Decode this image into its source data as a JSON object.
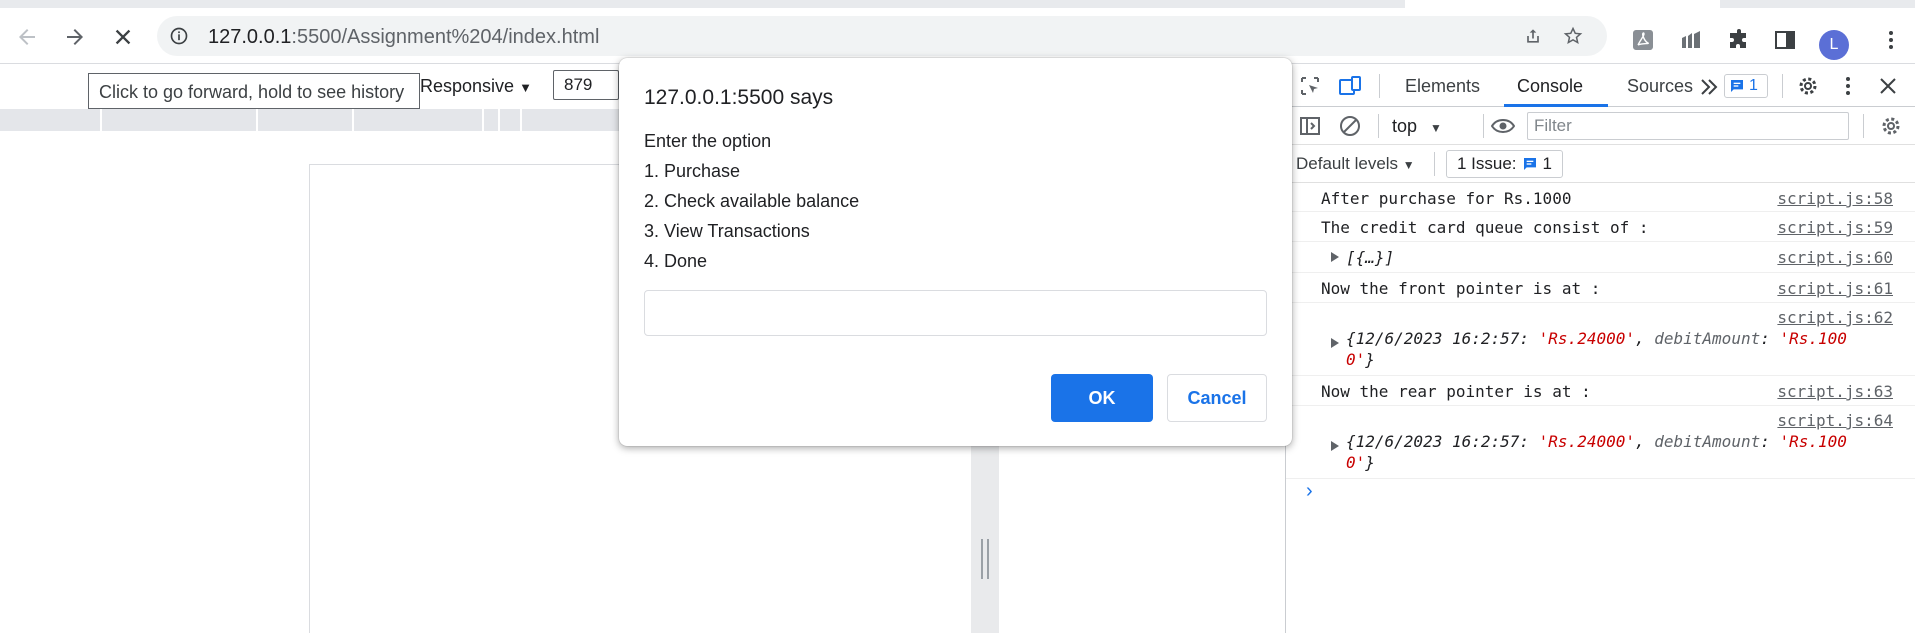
{
  "browser": {
    "url_host": "127.0.0.1",
    "url_path": ":5500/Assignment%204/index.html",
    "profile_initial": "L",
    "back_icon": "back-arrow-icon",
    "forward_icon": "forward-arrow-icon",
    "stop_icon": "stop-loading-icon",
    "forward_tooltip": "Click to go forward, hold to see history"
  },
  "device_toolbar": {
    "mode_label": "Responsive",
    "width_value": "879"
  },
  "dialog": {
    "title": "127.0.0.1:5500 says",
    "lines": [
      "Enter the option",
      "1. Purchase",
      "2. Check available balance",
      "3. View Transactions",
      "4. Done"
    ],
    "input_value": "",
    "ok_label": "OK",
    "cancel_label": "Cancel"
  },
  "devtools": {
    "tabs": [
      "Elements",
      "Console",
      "Sources"
    ],
    "active_tab": "Console",
    "issues_count": "1",
    "context": "top",
    "filter_placeholder": "Filter",
    "levels_label": "Default levels",
    "issue_chip_label": "1 Issue:",
    "issue_chip_count": "1",
    "logs": [
      {
        "text": "After purchase for Rs.1000",
        "source": "script.js:58"
      },
      {
        "text": "The credit card queue consist of :",
        "source": "script.js:59"
      },
      {
        "text": "[{…}]",
        "source": "script.js:60"
      },
      {
        "text": "Now the front pointer is at :",
        "source": "script.js:61"
      },
      {
        "source": "script.js:62",
        "obj_key": "{12/6/2023 16:2:57",
        "obj_val1": "'Rs.24000'",
        "obj_key2": "debitAmount",
        "obj_val2a": "'Rs.100",
        "obj_val2b": "0'"
      },
      {
        "text": "Now the rear pointer is at :",
        "source": "script.js:63"
      },
      {
        "source": "script.js:64",
        "obj_key": "{12/6/2023 16:2:57",
        "obj_val1": "'Rs.24000'",
        "obj_key2": "debitAmount",
        "obj_val2a": "'Rs.100",
        "obj_val2b": "0'"
      }
    ]
  }
}
